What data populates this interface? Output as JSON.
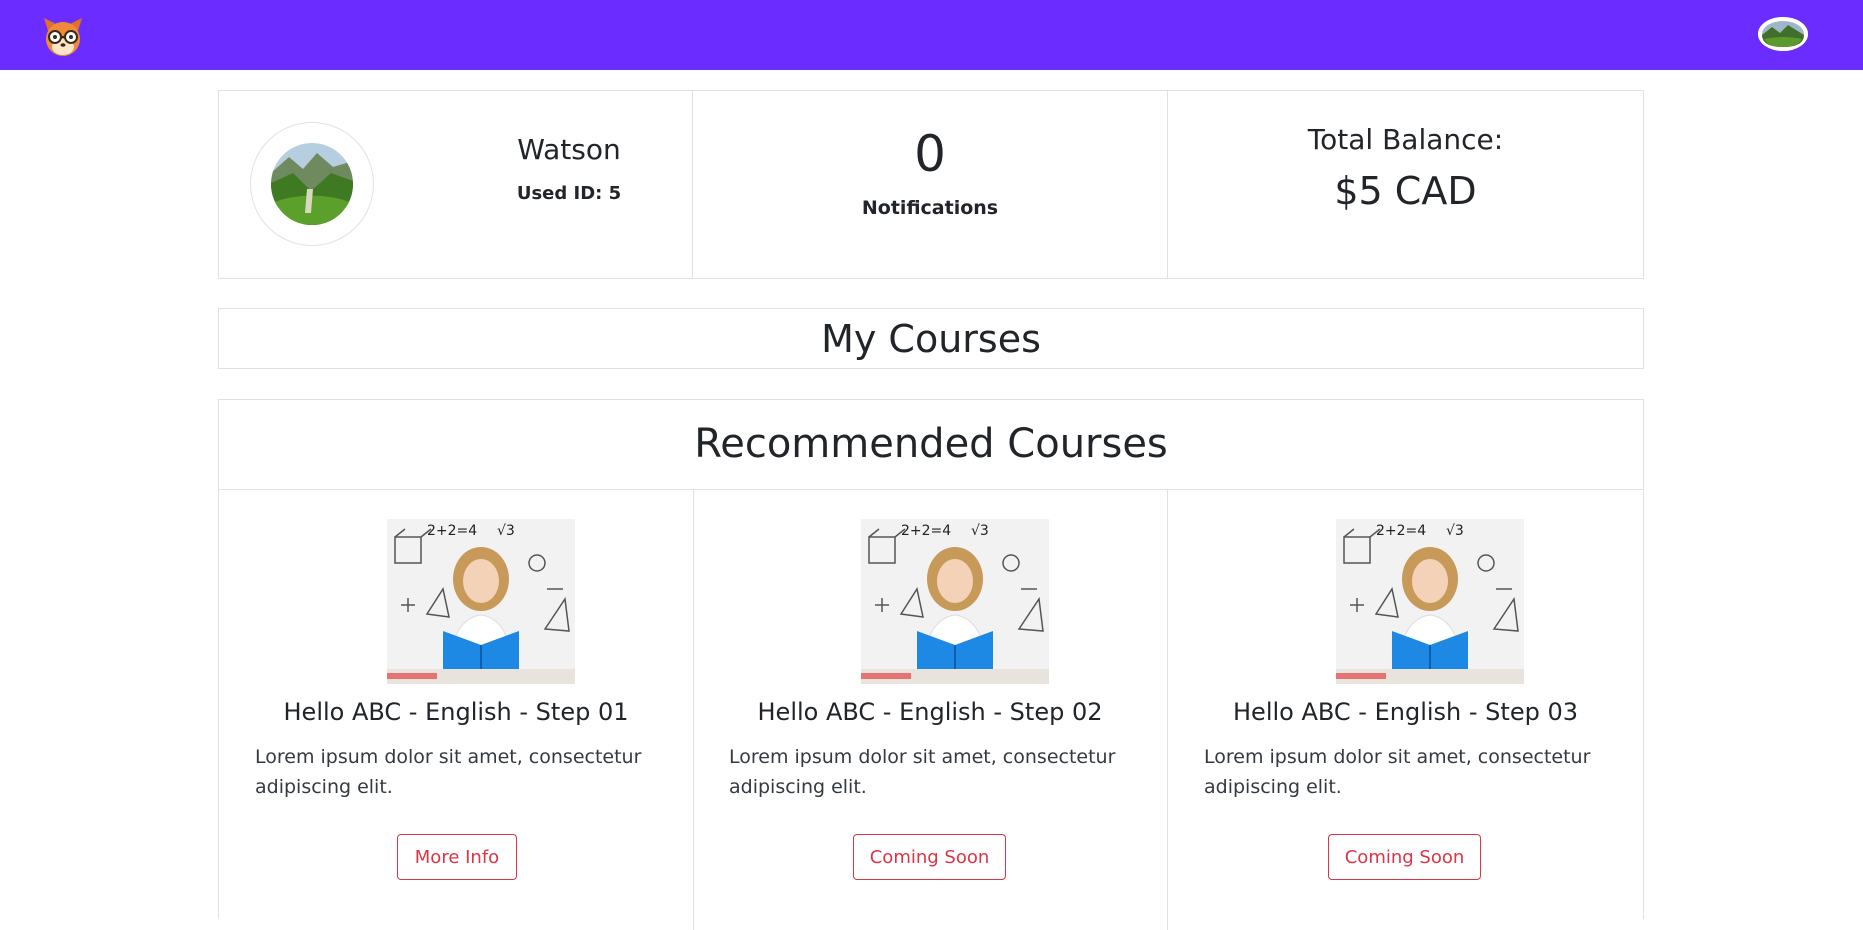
{
  "navbar": {
    "brand_color": "#6a2cff",
    "logo_icon": "fox-with-glasses-icon",
    "avatar_icon": "landscape-avatar-icon"
  },
  "profile": {
    "name": "Watson",
    "user_id_label": "Used ID: 5"
  },
  "notifications": {
    "count": "0",
    "label": "Notifications"
  },
  "balance": {
    "label": "Total Balance:",
    "value": "$5 CAD"
  },
  "my_courses": {
    "title": "My Courses"
  },
  "recommended": {
    "title": "Recommended Courses",
    "courses": [
      {
        "title": "Hello ABC - English - Step 01",
        "description": "Lorem ipsum dolor sit amet, consectetur adipiscing elit.",
        "button": "More Info"
      },
      {
        "title": "Hello ABC - English - Step 02",
        "description": "Lorem ipsum dolor sit amet, consectetur adipiscing elit.",
        "button": "Coming Soon"
      },
      {
        "title": "Hello ABC - English - Step 03",
        "description": "Lorem ipsum dolor sit amet, consectetur adipiscing elit.",
        "button": "Coming Soon"
      }
    ]
  },
  "colors": {
    "accent_button": "#dc3545",
    "border": "#dee2e6"
  }
}
